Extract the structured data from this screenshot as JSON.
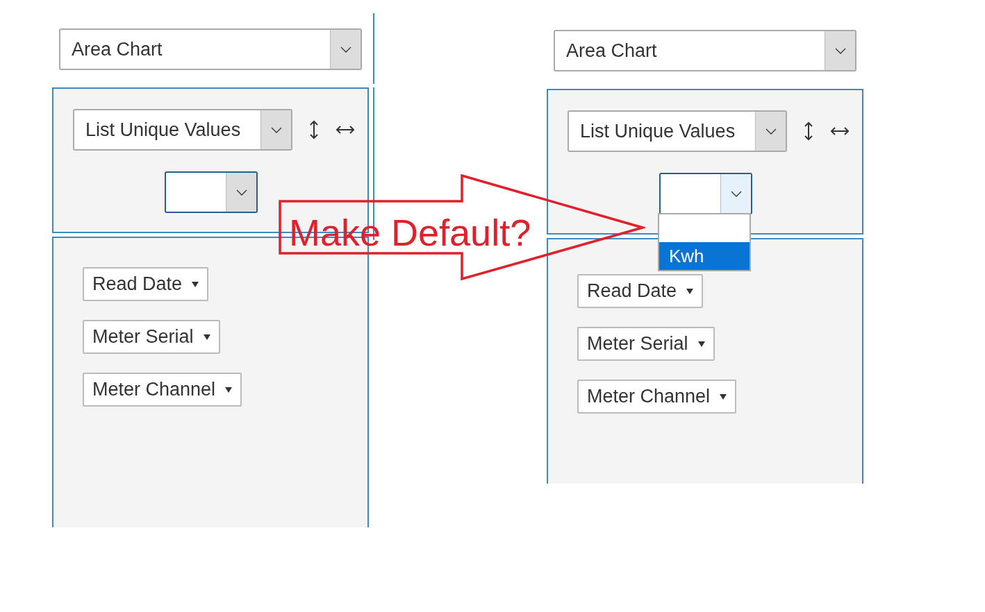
{
  "panels": [
    {
      "chart_type": "Area Chart",
      "aggregate": "List Unique Values",
      "value_dropdown": {
        "expanded": false
      },
      "fields": [
        "Read Date",
        "Meter Serial",
        "Meter Channel"
      ]
    },
    {
      "chart_type": "Area Chart",
      "aggregate": "List Unique Values",
      "value_dropdown": {
        "expanded": true,
        "options": [
          {
            "selected": false
          },
          {
            "label": "Kwh",
            "selected": true
          }
        ]
      },
      "fields": [
        "Read Date",
        "Meter Serial",
        "Meter Channel"
      ]
    }
  ],
  "annotation": {
    "text": "Make Default?"
  }
}
